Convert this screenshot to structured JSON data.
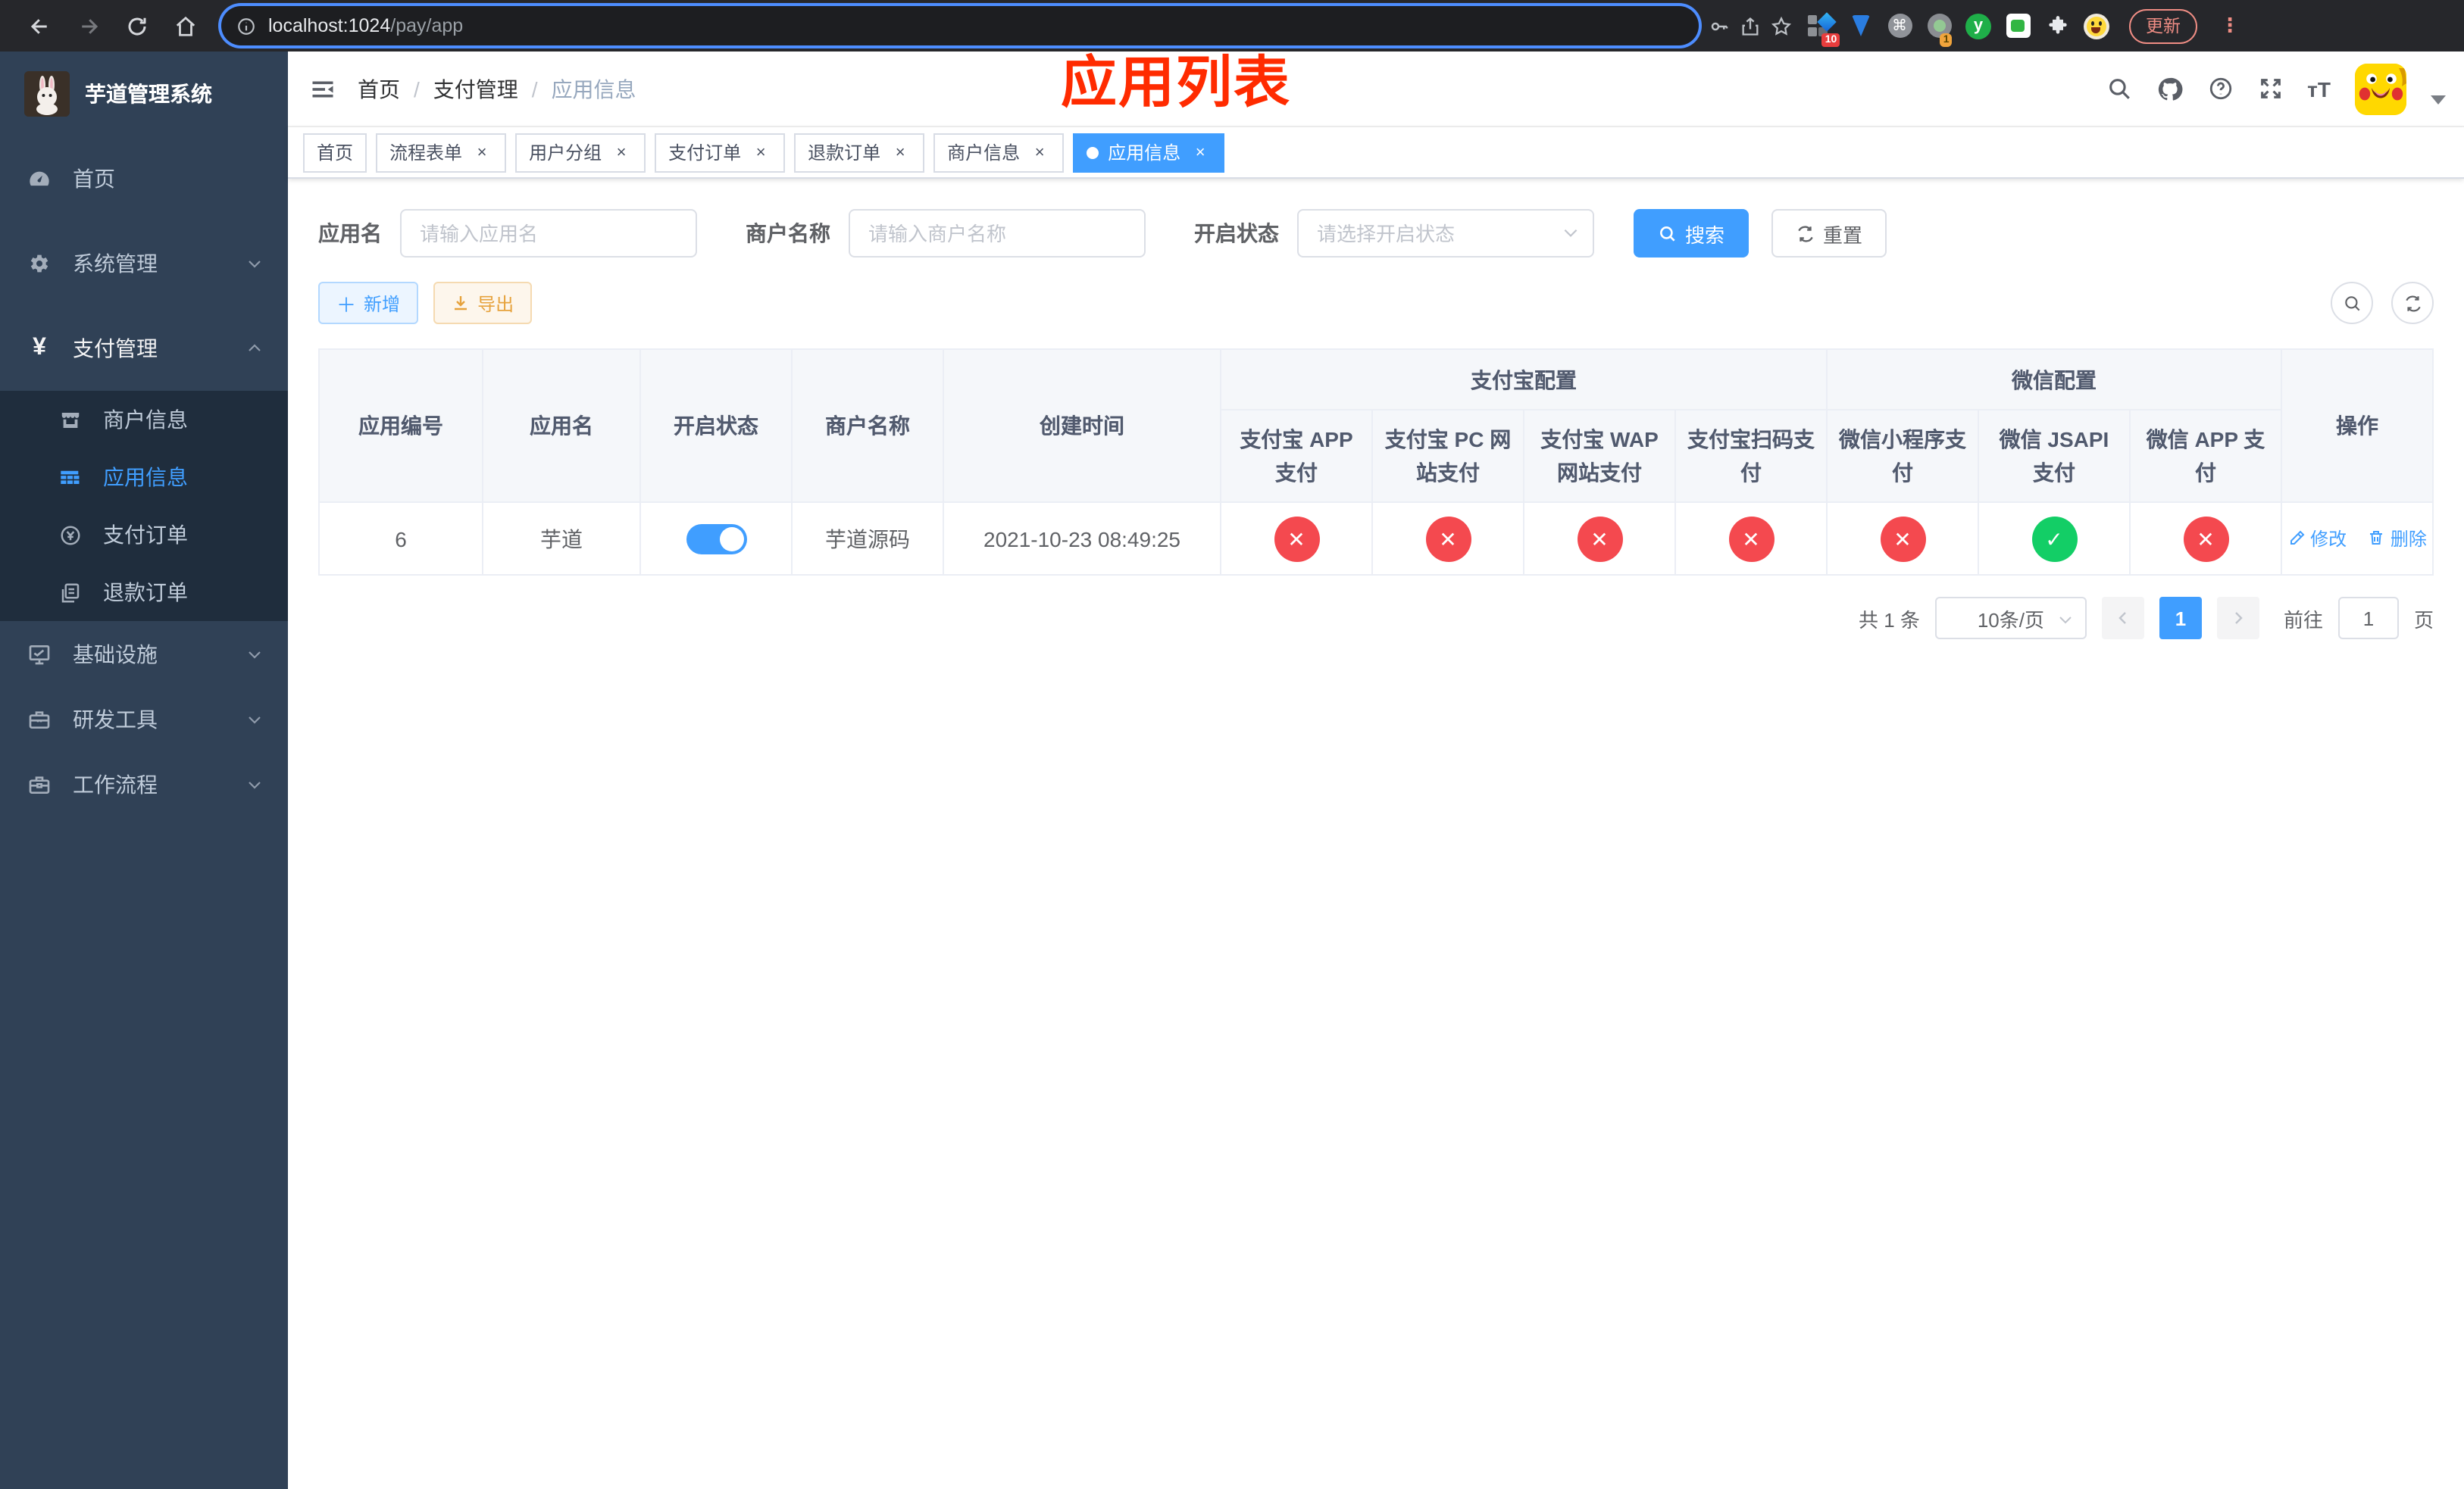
{
  "colors": {
    "primary": "#409eff",
    "success_circle": "#13ce66",
    "danger_circle": "#f4494f",
    "warning": "#e6a23c",
    "sidebar_bg": "#304156",
    "submenu_bg": "#1f2d3d",
    "annotation_red": "#ff2b00",
    "chrome_bg": "#26272b"
  },
  "browser": {
    "url_host": "localhost:1024",
    "url_path": "/pay/app",
    "update_label": "更新",
    "ext_badge_grid": "10",
    "ext_badge_record": "1"
  },
  "sidebar": {
    "app_title": "芋道管理系统",
    "menu_top": [
      {
        "label": "首页"
      },
      {
        "label": "系统管理"
      },
      {
        "label": "支付管理"
      }
    ],
    "submenu": [
      {
        "label": "商户信息"
      },
      {
        "label": "应用信息"
      },
      {
        "label": "支付订单"
      },
      {
        "label": "退款订单"
      }
    ],
    "menu_bottom": [
      {
        "label": "基础设施"
      },
      {
        "label": "研发工具"
      },
      {
        "label": "工作流程"
      }
    ]
  },
  "navbar": {
    "breadcrumb": [
      "首页",
      "支付管理",
      "应用信息"
    ],
    "annotation": "应用列表"
  },
  "tabs": [
    {
      "label": "首页",
      "closable": false,
      "active": false
    },
    {
      "label": "流程表单",
      "closable": true,
      "active": false
    },
    {
      "label": "用户分组",
      "closable": true,
      "active": false
    },
    {
      "label": "支付订单",
      "closable": true,
      "active": false
    },
    {
      "label": "退款订单",
      "closable": true,
      "active": false
    },
    {
      "label": "商户信息",
      "closable": true,
      "active": false
    },
    {
      "label": "应用信息",
      "closable": true,
      "active": true
    }
  ],
  "filters": {
    "app_name_label": "应用名",
    "app_name_placeholder": "请输入应用名",
    "merchant_label": "商户名称",
    "merchant_placeholder": "请输入商户名称",
    "status_label": "开启状态",
    "status_placeholder": "请选择开启状态",
    "search_label": "搜索",
    "reset_label": "重置"
  },
  "toolbar": {
    "add_label": "新增",
    "export_label": "导出"
  },
  "table": {
    "columns": [
      "应用编号",
      "应用名",
      "开启状态",
      "商户名称",
      "创建时间"
    ],
    "group_alipay": "支付宝配置",
    "group_wechat": "微信配置",
    "sub_columns": [
      "支付宝 APP 支付",
      "支付宝 PC 网站支付",
      "支付宝 WAP 网站支付",
      "支付宝扫码支付",
      "微信小程序支付",
      "微信 JSAPI 支付",
      "微信 APP 支付"
    ],
    "ops_header": "操作",
    "rows": [
      {
        "id": "6",
        "name": "芋道",
        "enabled": true,
        "merchant": "芋道源码",
        "created": "2021-10-23 08:49:25",
        "channels": [
          "closed",
          "closed",
          "closed",
          "closed",
          "closed",
          "open",
          "closed"
        ],
        "edit_label": "修改",
        "delete_label": "删除"
      }
    ]
  },
  "pagination": {
    "total": "共 1 条",
    "page_size": "10条/页",
    "current_page": "1",
    "goto_label": "前往",
    "page_unit": "页"
  }
}
